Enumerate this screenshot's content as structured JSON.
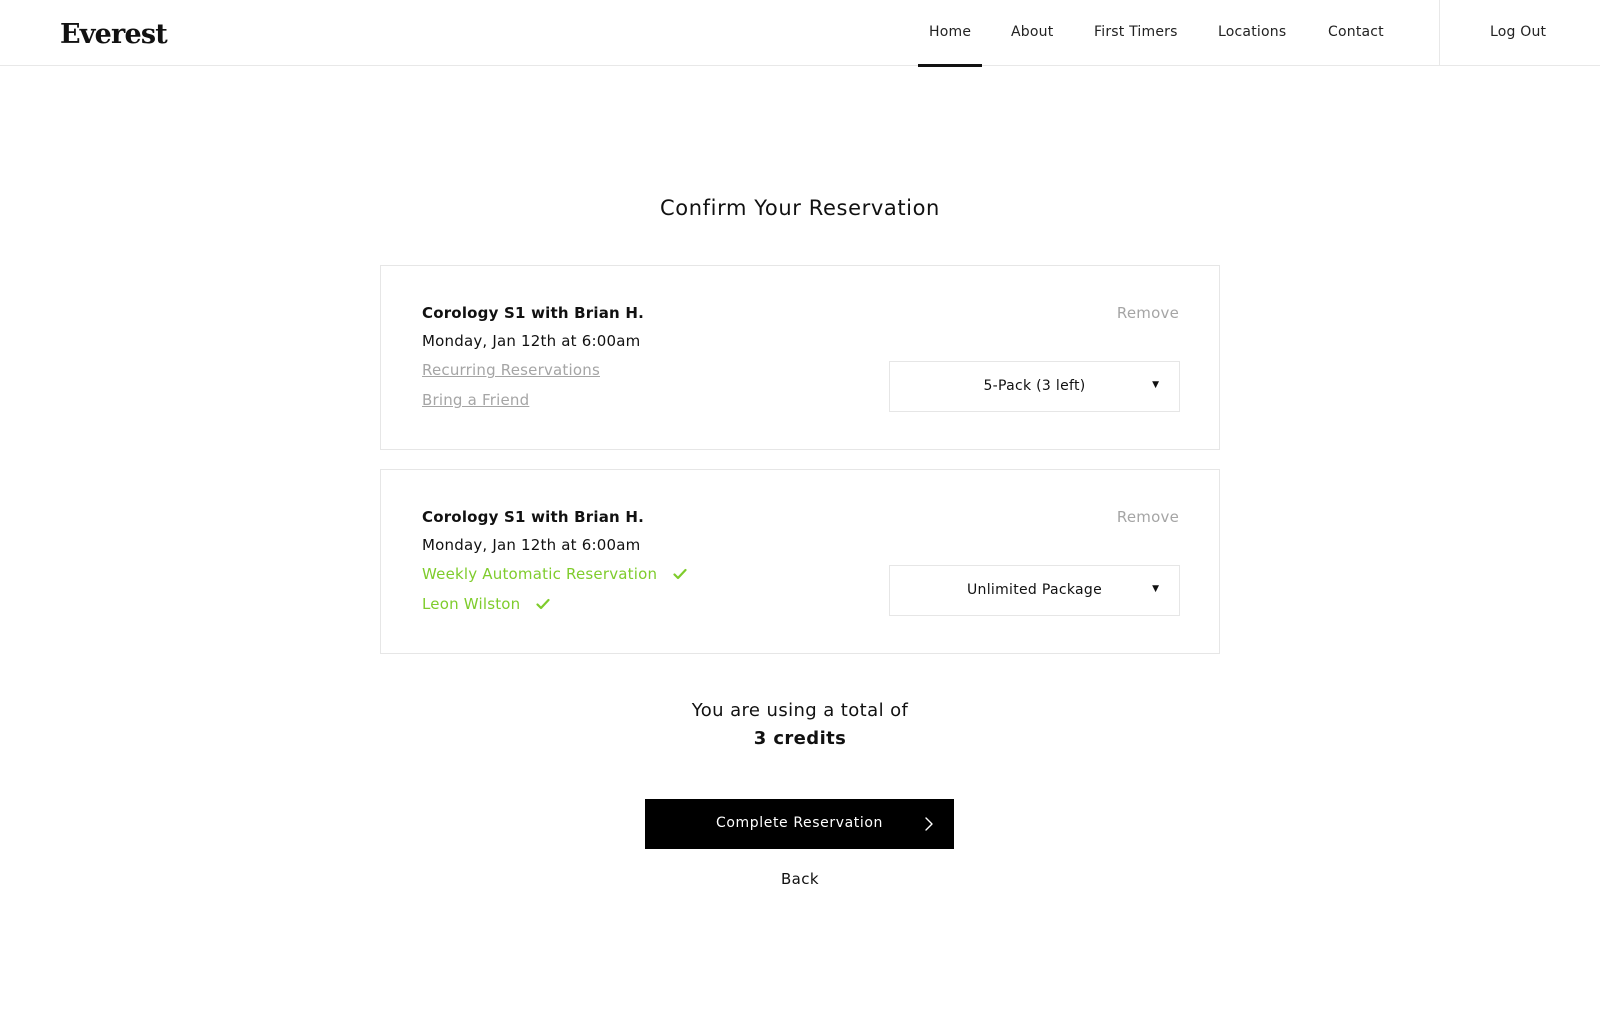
{
  "header": {
    "logo": "Everest",
    "nav": [
      {
        "label": "Home",
        "active": true
      },
      {
        "label": "About"
      },
      {
        "label": "First Timers"
      },
      {
        "label": "Locations"
      },
      {
        "label": "Contact"
      }
    ],
    "logout_label": "Log Out"
  },
  "page": {
    "title": "Confirm Your Reservation"
  },
  "reservations": [
    {
      "class_name": "Corology S1 with Brian H.",
      "datetime": "Monday, Jan 12th at 6:00am",
      "recurring_label": "Recurring Reservations",
      "friend_label": "Bring a Friend",
      "remove_label": "Remove",
      "package": "5-Pack (3 left)"
    },
    {
      "class_name": "Corology S1 with Brian H.",
      "datetime": "Monday, Jan 12th at 6:00am",
      "recurring_label": "Weekly Automatic Reservation",
      "friend_label": "Leon Wilston",
      "remove_label": "Remove",
      "package": "Unlimited Package"
    }
  ],
  "summary": {
    "line1": "You are using a total of",
    "credits": "3 credits"
  },
  "actions": {
    "complete_label": "Complete Reservation",
    "back_label": "Back"
  },
  "colors": {
    "accent_green": "#7fcc2c",
    "muted": "#a5a5a5",
    "button_bg": "#000000"
  }
}
